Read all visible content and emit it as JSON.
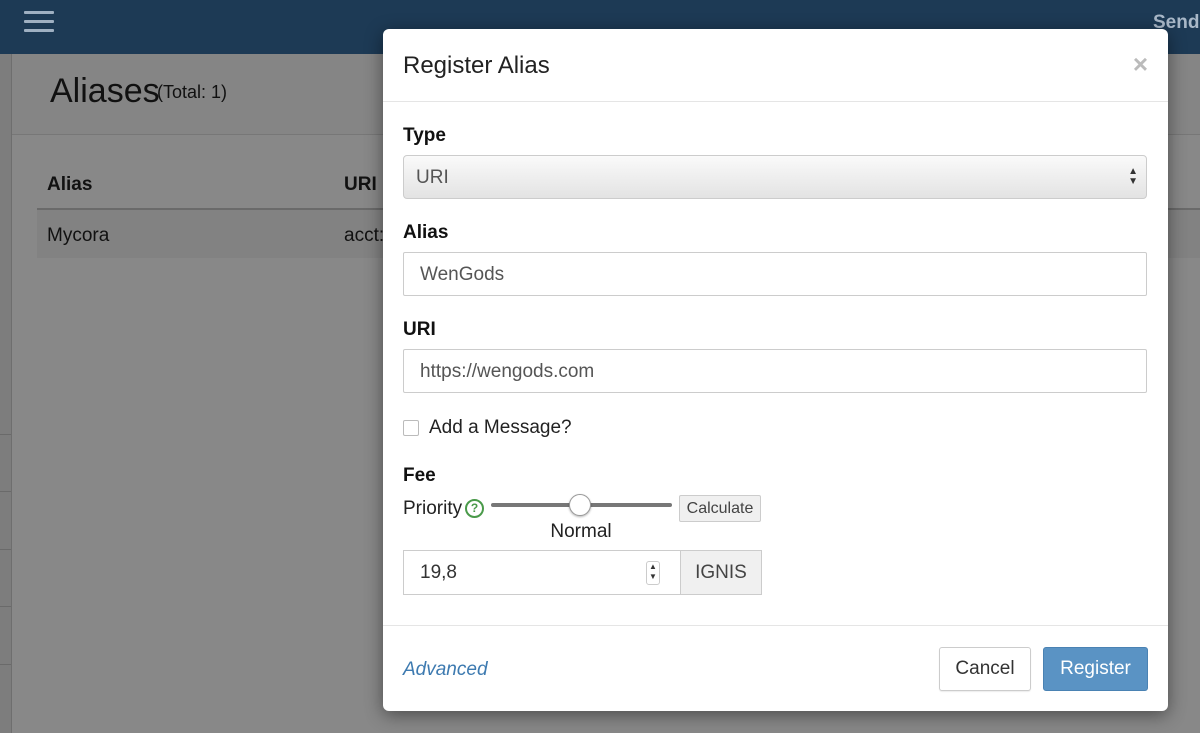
{
  "topbar": {
    "menu_icon": "hamburger-icon",
    "send_label": "Send I"
  },
  "page": {
    "title": "Aliases",
    "total": "(Total: 1)",
    "table": {
      "columns": [
        "Alias",
        "URI"
      ],
      "rows": [
        {
          "alias": "Mycora",
          "uri": "acct:"
        }
      ]
    }
  },
  "modal": {
    "title": "Register Alias",
    "close_label": "×",
    "type": {
      "label": "Type",
      "value": "URI"
    },
    "alias": {
      "label": "Alias",
      "value": "WenGods"
    },
    "uri": {
      "label": "URI",
      "value": "https://wengods.com"
    },
    "message_checkbox": {
      "label": "Add a Message?",
      "checked": false
    },
    "fee": {
      "label": "Fee",
      "priority_label": "Priority",
      "help_icon": "question-circle-icon",
      "priority_value": "Normal",
      "calculate_label": "Calculate",
      "amount": "19,8",
      "unit": "IGNIS"
    },
    "footer": {
      "advanced_label": "Advanced",
      "cancel_label": "Cancel",
      "register_label": "Register"
    }
  },
  "colors": {
    "topbar": "#1d3a55",
    "primary_button": "#5a93c4",
    "link": "#3d7ab0",
    "help_icon": "#4a9a4a"
  }
}
